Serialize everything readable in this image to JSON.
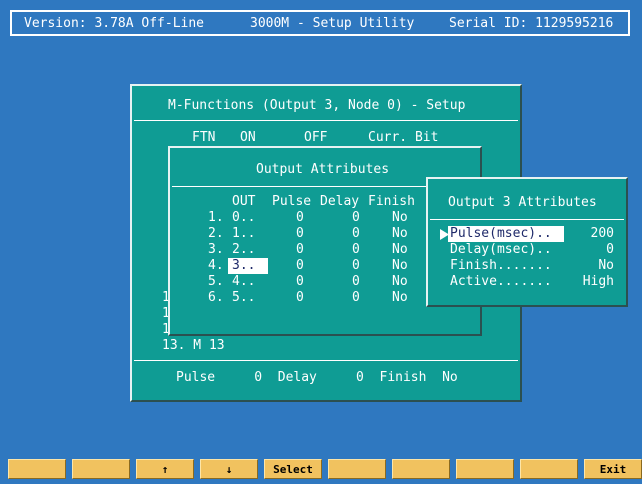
{
  "header": {
    "version": "Version: 3.78A Off-Line",
    "title": "3000M - Setup Utility",
    "serial": "Serial ID: 1129595216"
  },
  "mfunc": {
    "title": "M-Functions (Output 3, Node 0) - Setup",
    "col_ftn": "FTN",
    "col_on": "ON",
    "col_off": "OFF",
    "col_curr": "Curr. Bit",
    "partial_rows": [
      "1",
      "1",
      "1"
    ],
    "row13": "13. M 13",
    "footer": "Pulse     0  Delay     0  Finish  No"
  },
  "attrs": {
    "title": "Output Attributes",
    "headers": {
      "out": "OUT",
      "pulse": "Pulse",
      "delay": "Delay",
      "finish": "Finish"
    },
    "rows": [
      {
        "idx": "1.",
        "out": "0..",
        "pulse": "0",
        "delay": "0",
        "finish": "No"
      },
      {
        "idx": "2.",
        "out": "1..",
        "pulse": "0",
        "delay": "0",
        "finish": "No"
      },
      {
        "idx": "3.",
        "out": "2..",
        "pulse": "0",
        "delay": "0",
        "finish": "No"
      },
      {
        "idx": "4.",
        "out": "3..",
        "pulse": "0",
        "delay": "0",
        "finish": "No"
      },
      {
        "idx": "5.",
        "out": "4..",
        "pulse": "0",
        "delay": "0",
        "finish": "No"
      },
      {
        "idx": "6.",
        "out": "5..",
        "pulse": "0",
        "delay": "0",
        "finish": "No"
      }
    ]
  },
  "out3": {
    "title": "Output 3 Attributes",
    "fields": [
      {
        "label": "Pulse(msec)..",
        "value": "200"
      },
      {
        "label": "Delay(msec)..",
        "value": "0"
      },
      {
        "label": "Finish.......",
        "value": "No"
      },
      {
        "label": "Active.......",
        "value": "High"
      }
    ]
  },
  "footer": {
    "keys": [
      "",
      "",
      "↑",
      "↓",
      "Select",
      "",
      "",
      "",
      "",
      "Exit"
    ]
  }
}
